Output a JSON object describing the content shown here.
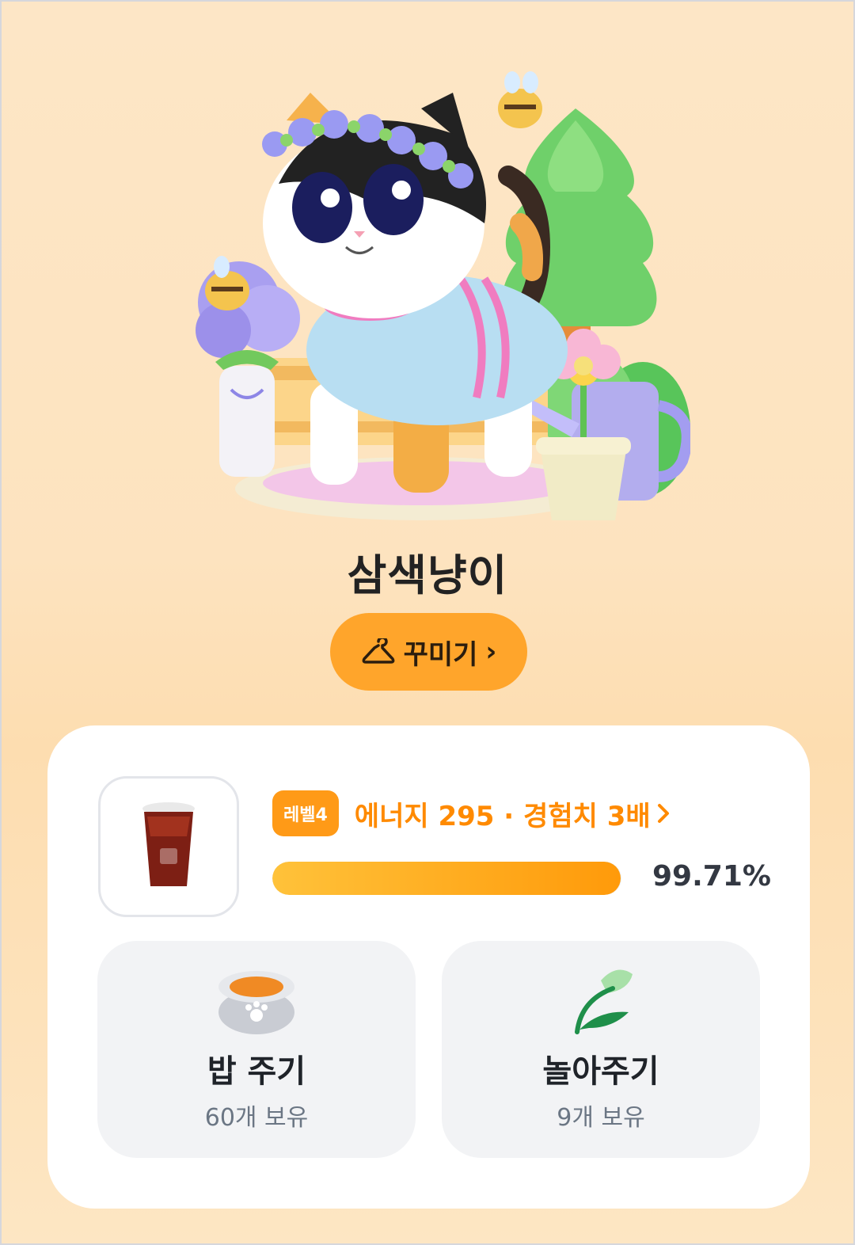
{
  "pet": {
    "name": "삼색냥이",
    "illustration_icon": "calico-cat-flower-crown-garden-illustration"
  },
  "decorate_button": {
    "label": "꾸미기",
    "icon": "hanger-icon",
    "chevron": "›"
  },
  "status": {
    "item_icon": "iced-tea-cup-icon",
    "level_badge": "레벨4",
    "energy_text": "에너지 295 · 경험치 3배",
    "progress_percent": 99.71,
    "progress_label": "99.71%"
  },
  "actions": [
    {
      "title": "밥 주기",
      "sub": "60개 보유",
      "icon": "food-bowl-icon"
    },
    {
      "title": "놀아주기",
      "sub": "9개 보유",
      "icon": "leaf-toy-icon"
    }
  ],
  "colors": {
    "accent": "#ffa52b",
    "energy_text": "#ff8a00",
    "background": "#fde3bf"
  }
}
